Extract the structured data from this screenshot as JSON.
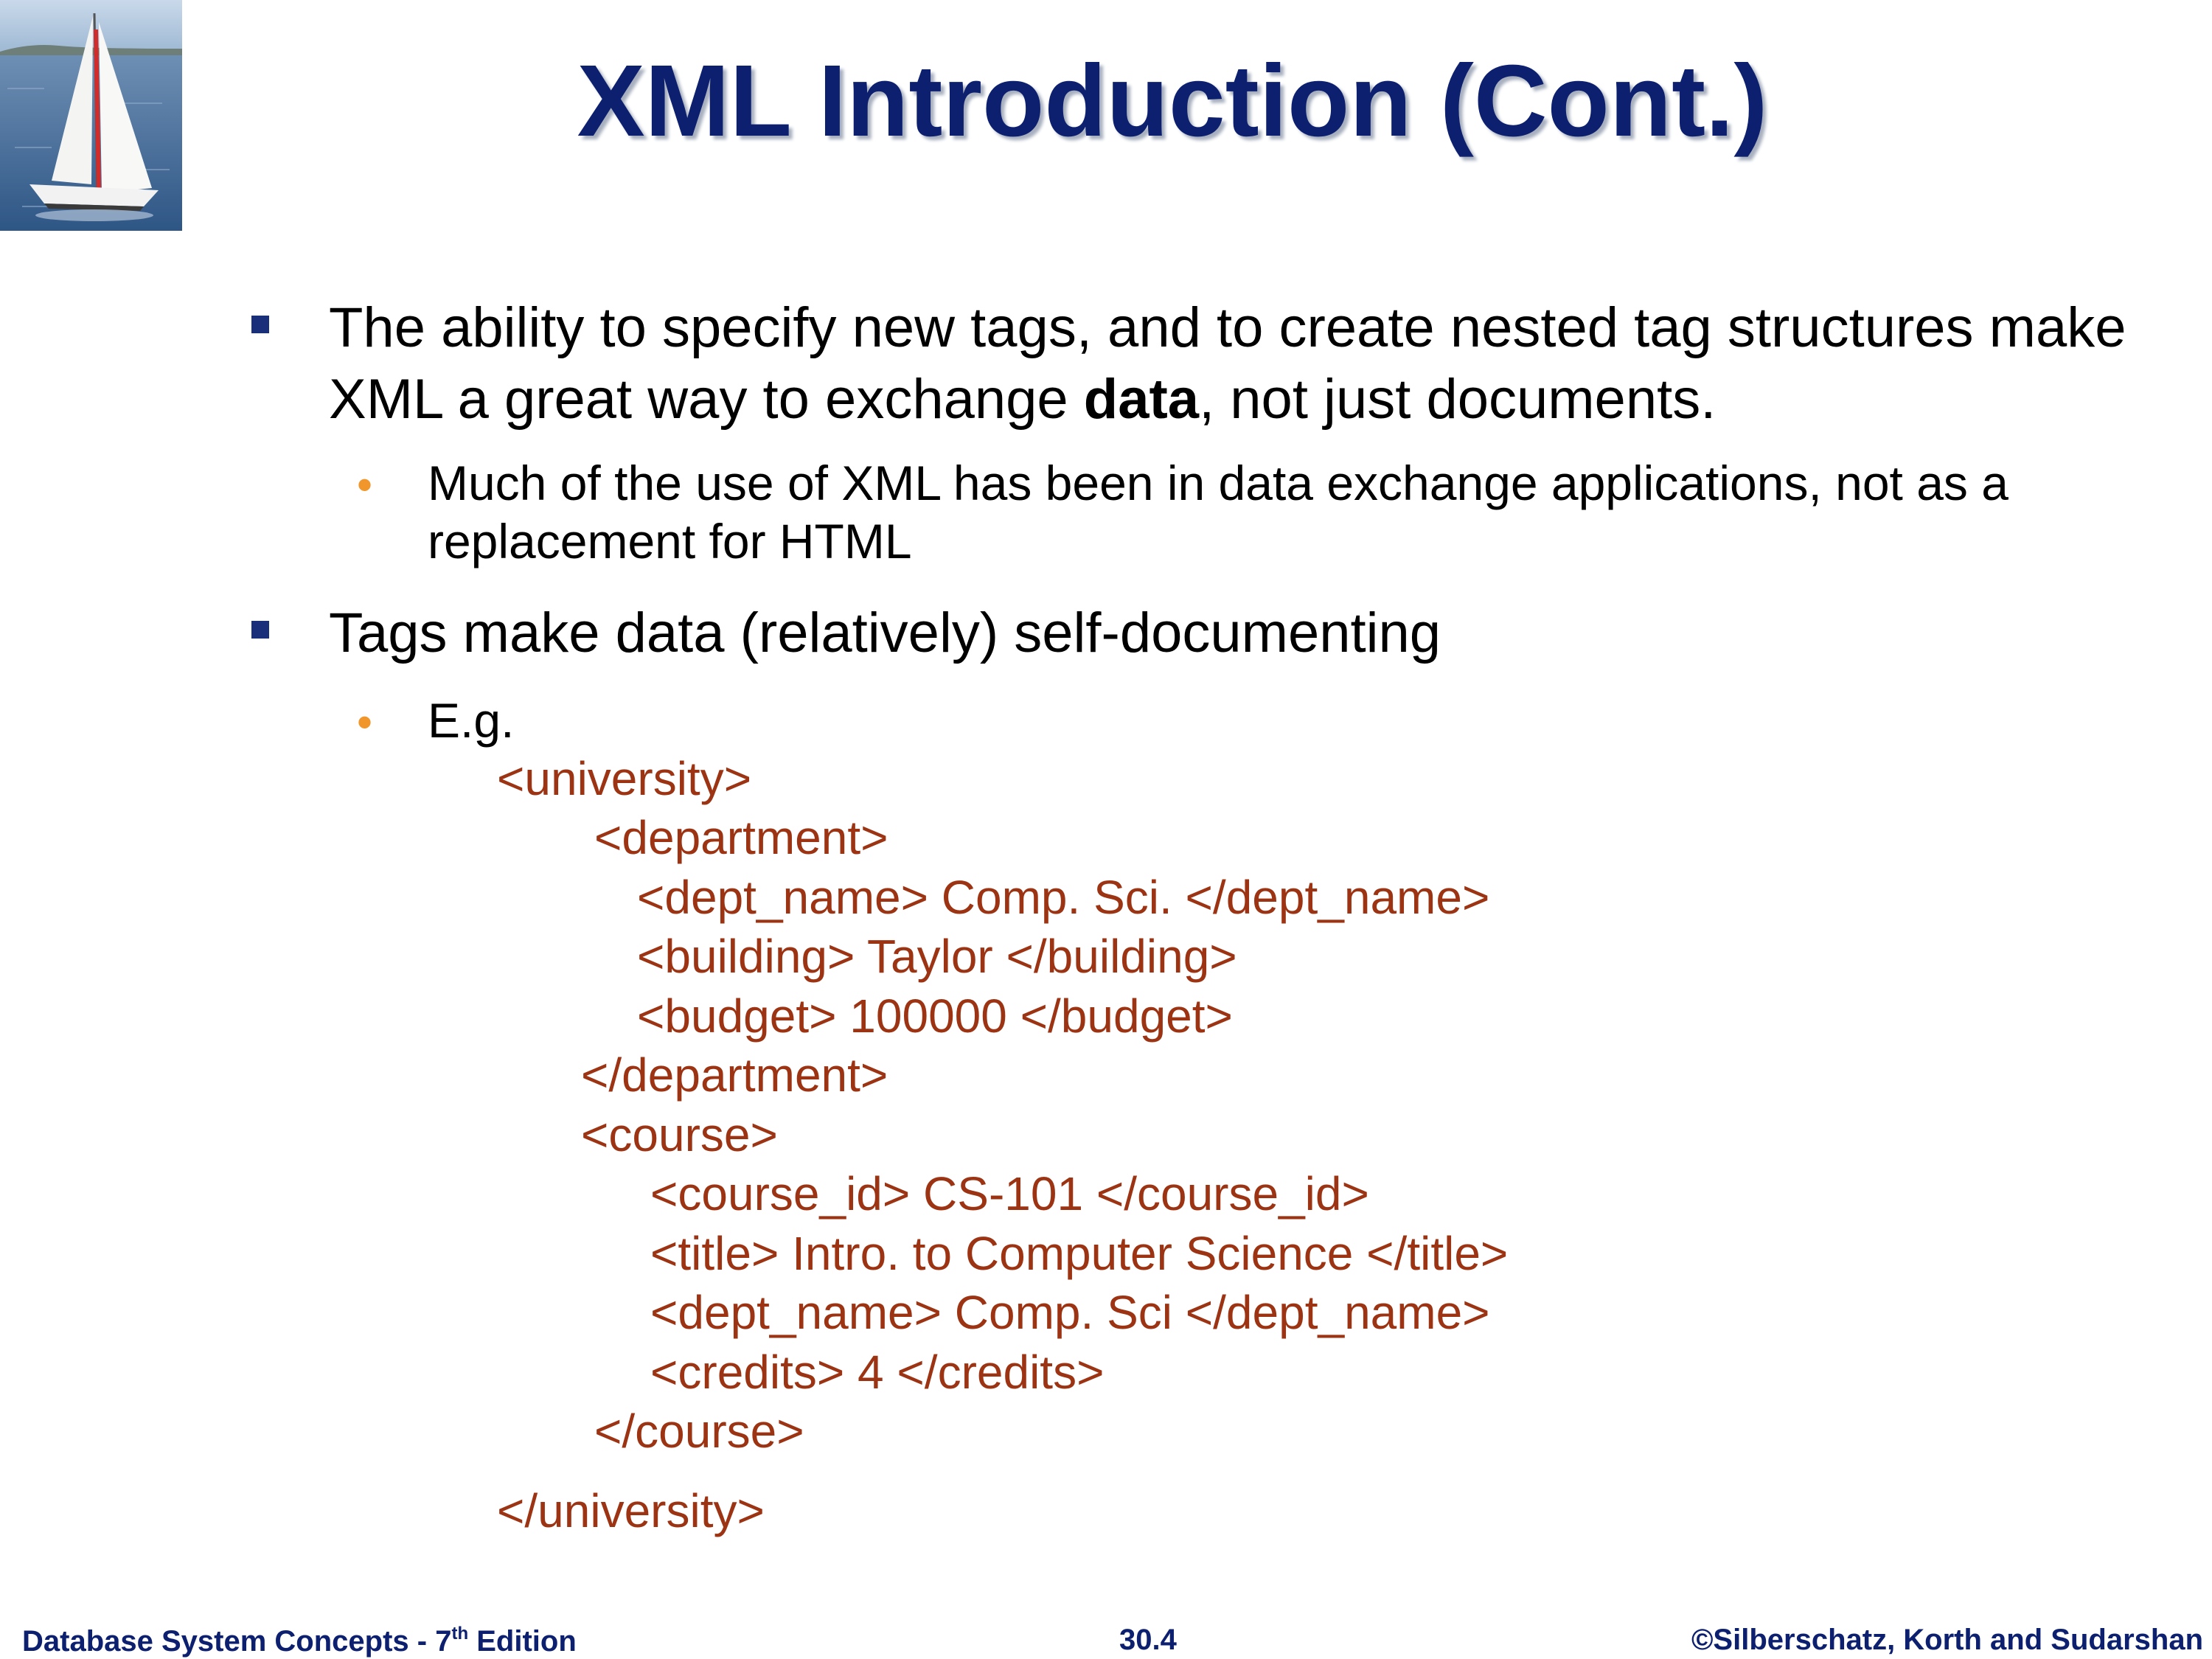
{
  "slide": {
    "title": "XML Introduction (Cont.)",
    "bullets": [
      {
        "parts": [
          "The ability to specify new tags, and to create nested tag structures make XML a great way to exchange ",
          "data",
          ", not just documents."
        ]
      },
      {
        "text": "Tags make data (relatively) self-documenting"
      }
    ],
    "subbullets": [
      "Much of the use of XML has been in data exchange applications, not as a replacement for HTML",
      "E.g."
    ],
    "xml_lines": [
      "<university>",
      "<department>",
      "<dept_name> Comp. Sci. </dept_name>",
      "<building> Taylor </building>",
      "<budget> 100000 </budget>",
      "</department>",
      "<course>",
      "<course_id> CS-101 </course_id>",
      "<title> Intro. to Computer Science </title>",
      "<dept_name> Comp. Sci </dept_name>",
      "<credits> 4 </credits>",
      "</course>",
      "</university>"
    ]
  },
  "footer": {
    "left_main": "Database System Concepts - 7",
    "left_sup": "th",
    "left_end": " Edition",
    "center": "30.4",
    "right": "©Silberschatz, Korth and Sudarshan"
  },
  "colors": {
    "title": "#0d2070",
    "bullet_square": "#1a2f7a",
    "sub_bullet_dot": "#f0962a",
    "xml_text": "#9c3414"
  }
}
